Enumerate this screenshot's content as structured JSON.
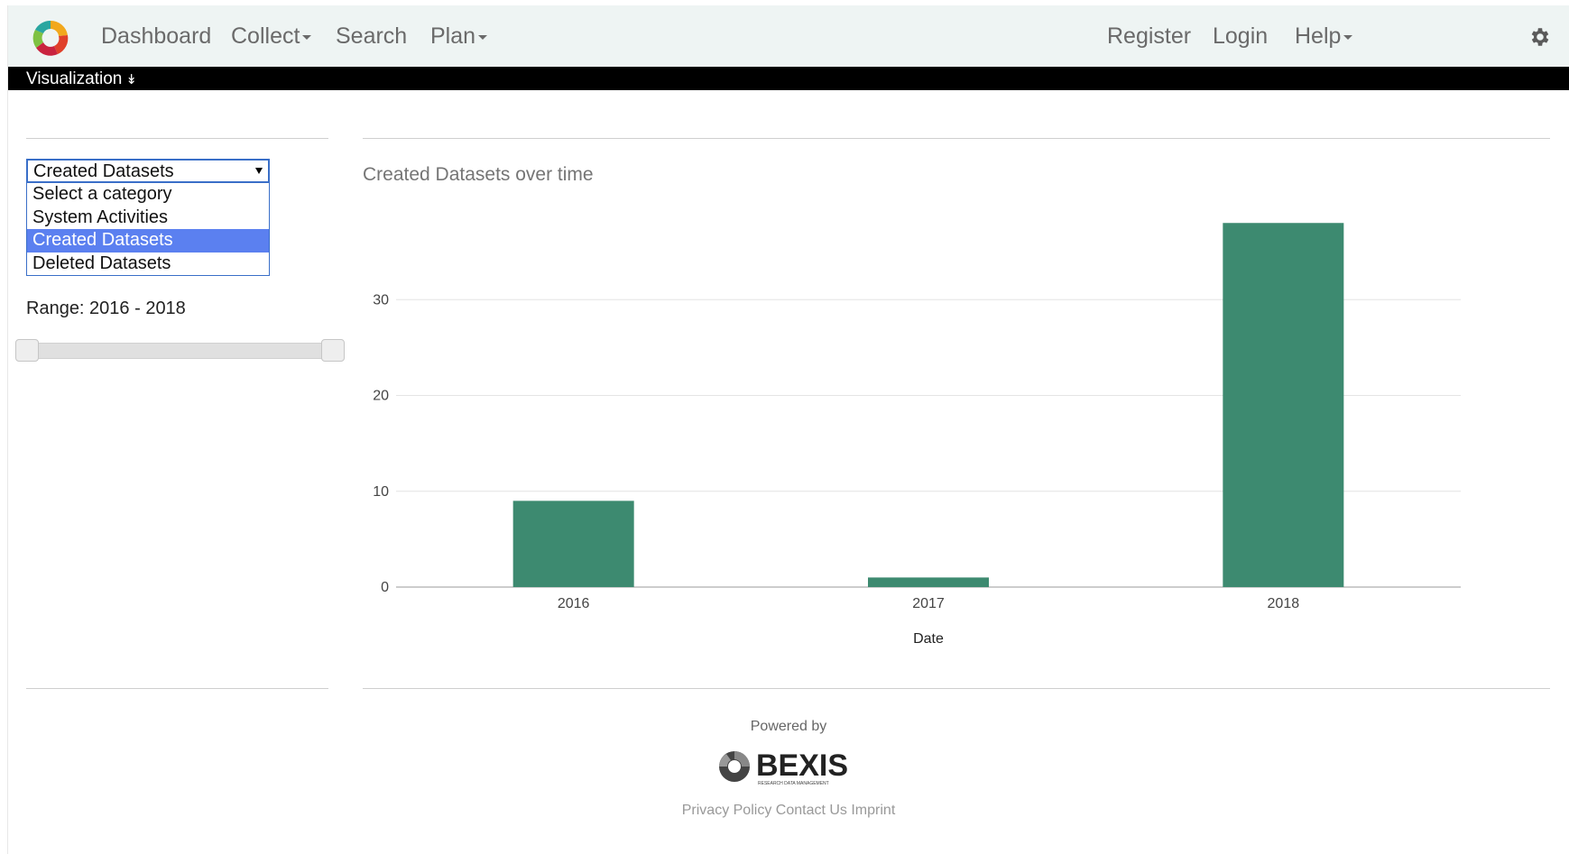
{
  "navbar": {
    "left_items": [
      {
        "label": "Dashboard",
        "dropdown": false
      },
      {
        "label": "Collect",
        "dropdown": true
      },
      {
        "label": "Search",
        "dropdown": false
      },
      {
        "label": "Plan",
        "dropdown": true
      }
    ],
    "right_items": [
      {
        "label": "Register",
        "dropdown": false
      },
      {
        "label": "Login",
        "dropdown": false
      },
      {
        "label": "Help",
        "dropdown": true
      }
    ],
    "settings_icon": "gear-icon",
    "logo_icon": "app-logo-icon"
  },
  "subbar": {
    "label": "Visualization",
    "chevron": "»"
  },
  "category_select": {
    "selected": "Created Datasets",
    "options": [
      "Select a category",
      "System Activities",
      "Created Datasets",
      "Deleted Datasets"
    ],
    "selected_index": 2
  },
  "range": {
    "label": "Range: 2016 - 2018",
    "min": 2016,
    "max": 2018
  },
  "chart": {
    "title": "Created Datasets over time"
  },
  "chart_data": {
    "type": "bar",
    "title": "Created Datasets over time",
    "categories": [
      "2016",
      "2017",
      "2018"
    ],
    "values": [
      9,
      1,
      38
    ],
    "xlabel": "Date",
    "ylabel": "",
    "ylim": [
      0,
      40
    ],
    "yticks": [
      0,
      10,
      20,
      30
    ],
    "bar_color": "#3d8a70",
    "grid": true,
    "legend": false
  },
  "footer": {
    "powered_by": "Powered by",
    "brand": "BEXIS",
    "brand_tagline": "RESEARCH DATA MANAGEMENT",
    "links": [
      "Privacy Policy",
      "Contact Us",
      "Imprint"
    ]
  },
  "colors": {
    "navbar_bg": "#eef4f3",
    "subbar_bg": "#000000",
    "select_highlight": "#5b80f0",
    "bar": "#3d8a70"
  }
}
